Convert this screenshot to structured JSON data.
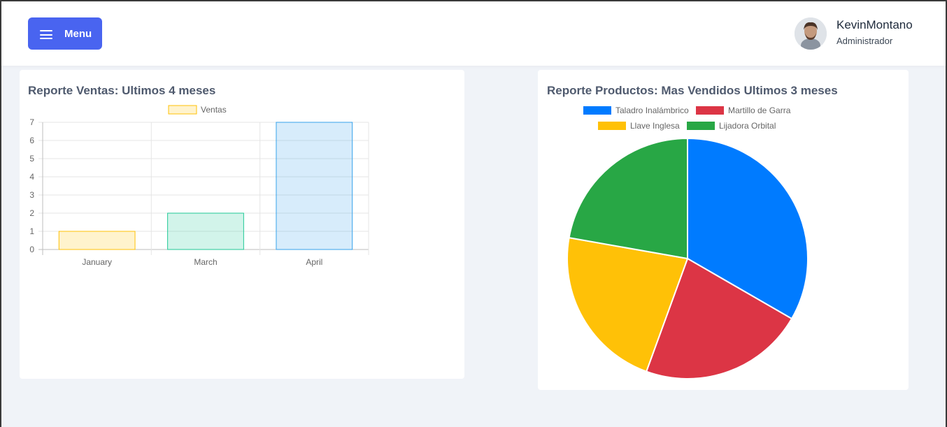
{
  "header": {
    "menu_label": "Menu",
    "user_name": "KevinMontano",
    "user_role": "Administrador"
  },
  "sales_report": {
    "title": "Reporte Ventas: Ultimos 4 meses"
  },
  "products_report": {
    "title": "Reporte Productos: Mas Vendidos Ultimos 3 meses"
  },
  "chart_data": [
    {
      "type": "bar",
      "title": "Reporte Ventas: Ultimos 4 meses",
      "categories": [
        "January",
        "March",
        "April"
      ],
      "series": [
        {
          "name": "Ventas",
          "values": [
            1,
            2,
            7
          ]
        }
      ],
      "ylim": [
        0,
        7
      ],
      "yticks": [
        0,
        1,
        2,
        3,
        4,
        5,
        6,
        7
      ],
      "bar_colors": [
        "#ffc107",
        "#20c997",
        "#36a2eb"
      ],
      "legend_color": "#ffc107",
      "grid": true,
      "legend": "top-center"
    },
    {
      "type": "pie",
      "title": "Reporte Productos: Mas Vendidos Ultimos 3 meses",
      "labels": [
        "Taladro Inalámbrico",
        "Martillo de Garra",
        "Llave Inglesa",
        "Lijadora Orbital"
      ],
      "values": [
        6,
        4,
        4,
        4
      ],
      "colors": [
        "#007bff",
        "#dc3545",
        "#ffc107",
        "#28a745"
      ],
      "legend": "top-center"
    }
  ]
}
